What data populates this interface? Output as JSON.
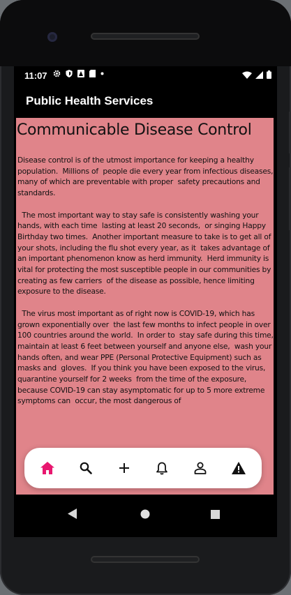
{
  "status_bar": {
    "time": "11:07"
  },
  "app_bar": {
    "title": "Public Health Services"
  },
  "article": {
    "title": "Communicable Disease Control",
    "body": "Disease control is of the utmost importance for keeping a healthy population.  Millions of  people die every year from infectious diseases, many of which are preventable with proper  safety precautions and standards.\n\n  The most important way to stay safe is consistently washing your hands, with each time  lasting at least 20 seconds,  or singing Happy Birthday two times.  Another important measure to take is to get all of your shots, including the flu shot every year, as it  takes advantage of an important phenomenon know as herd immunity.  Herd immunity is vital for protecting the most susceptible people in our communities by creating as few carriers  of the disease as possible, hence limiting exposure to the disease.\n\n  The virus most important as of right now is COVID-19, which has grown exponentially over  the last few months to infect people in over 100 countries around the world.  In order to  stay safe during this time, maintain at least 6 feet between yourself and anyone else,  wash your hands often, and wear PPE (Personal Protective Equipment) such as masks and  gloves.  If you think you have been exposed to the virus, quarantine yourself for 2 weeks  from the time of the exposure, because COVID-19 can stay asymptomatic for up to 5 more extreme symptoms can  occur, the most dangerous of"
  },
  "bottom_nav": {
    "items": [
      {
        "icon": "home-icon",
        "active": true
      },
      {
        "icon": "search-icon",
        "active": false
      },
      {
        "icon": "plus-icon",
        "active": false
      },
      {
        "icon": "bell-icon",
        "active": false
      },
      {
        "icon": "person-icon",
        "active": false
      },
      {
        "icon": "warning-icon",
        "active": false
      }
    ],
    "active_color": "#e8176f",
    "inactive_color": "#111111"
  },
  "colors": {
    "content_bg": "#e0848a",
    "app_bar_bg": "#000000"
  }
}
